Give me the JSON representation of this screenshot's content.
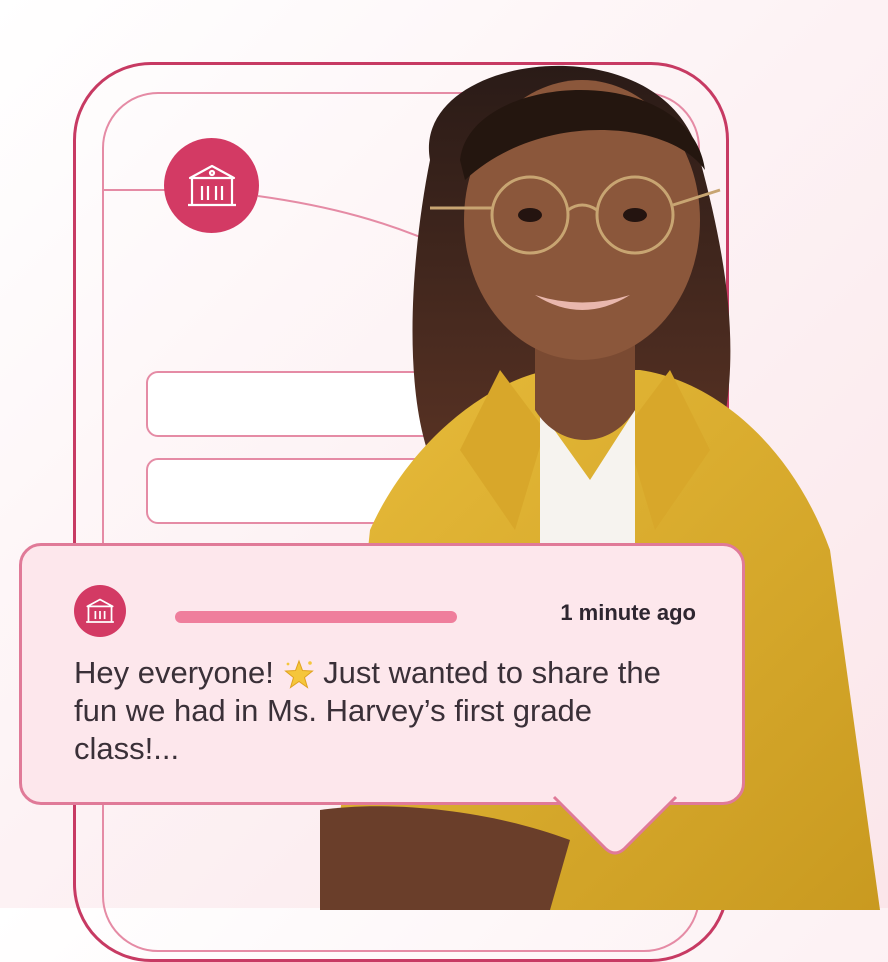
{
  "notification": {
    "timestamp": "1 minute ago",
    "message": "Hey everyone! 🌟 Just wanted to share the fun we had in Ms. Harvey’s first grade class!...",
    "message_before_emoji": "Hey everyone! ",
    "emoji": "sparkle-star-icon",
    "message_after_emoji": " Just wanted to share the fun we had in Ms. Harvey’s first grade class!..."
  },
  "icons": {
    "school": "school-building-icon",
    "emoji": "star-emoji-icon"
  },
  "colors": {
    "accent": "#d33a64",
    "outline_dark": "#c73a63",
    "outline_light": "#e58ba5",
    "card_bg": "#fde7ec",
    "card_border": "#e07a98",
    "name_placeholder": "#ef7e9c",
    "jacket": "#e2b22c"
  }
}
